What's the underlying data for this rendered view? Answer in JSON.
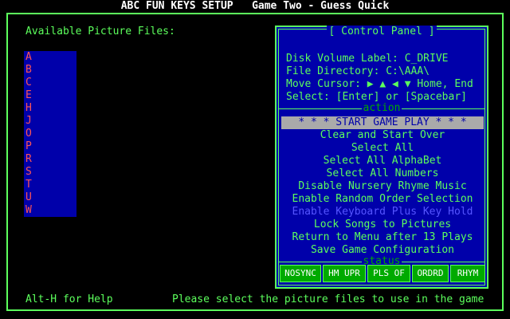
{
  "title": "ABC FUN KEYS SETUP   Game Two - Guess Quick",
  "available_label": "Available Picture Files:",
  "files": [
    "A",
    "B",
    "C",
    "E",
    "H",
    "J",
    "O",
    "P",
    "R",
    "S",
    "T",
    "U",
    "W"
  ],
  "panel": {
    "title": "[ Control Panel ]",
    "info": [
      "Disk Volume Label: C_DRIVE",
      "File Directory: C:\\AAA\\",
      "Move Cursor: ▶ ▲ ◀ ▼ Home, End",
      "Select: [Enter] or [Spacebar]"
    ],
    "action_label": "action",
    "menu": [
      {
        "label": "* * * START GAME PLAY * * *",
        "state": "selected"
      },
      {
        "label": "Clear and Start Over",
        "state": "normal"
      },
      {
        "label": "Select All",
        "state": "normal"
      },
      {
        "label": "Select All AlphaBet",
        "state": "normal"
      },
      {
        "label": "Select All Numbers",
        "state": "normal"
      },
      {
        "label": "Disable Nursery Rhyme Music",
        "state": "normal"
      },
      {
        "label": "Enable Random Order Selection",
        "state": "normal"
      },
      {
        "label": "Enable Keyboard Plus Key Hold",
        "state": "disabled"
      },
      {
        "label": "Lock Songs to Pictures",
        "state": "normal"
      },
      {
        "label": "Return to Menu after 13 Plays",
        "state": "normal"
      },
      {
        "label": "Save Game Configuration",
        "state": "normal"
      }
    ],
    "status_label": "status",
    "status": [
      "NOSYNC",
      "HM UPR",
      "PLS OF",
      "ORDRD",
      "RHYM"
    ]
  },
  "help": "Alt-H for Help",
  "message": "Please select the picture files to use in the game",
  "colors": {
    "background": "#000000",
    "border": "#5cff5c",
    "panel": "#0000aa",
    "file_text": "#ff5555",
    "selected_bg": "#aaaaaa",
    "disabled_text": "#5555ff",
    "status_bg": "#00aa00"
  }
}
